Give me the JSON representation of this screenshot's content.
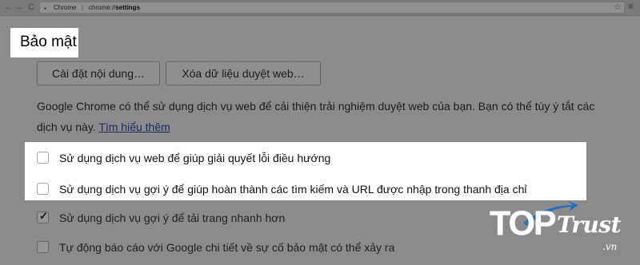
{
  "browser": {
    "nav": {
      "back": "←",
      "forward": "→",
      "reload": "C"
    },
    "tab_label": "Chrome",
    "url_separator": "|",
    "url_scheme": "chrome://",
    "url_path": "settings",
    "star": "☆",
    "menu": "≡"
  },
  "section": {
    "title": "Bảo mật"
  },
  "buttons": {
    "content_settings": "Cài đặt nội dung…",
    "clear_browsing_data": "Xóa dữ liệu duyệt web…"
  },
  "description": {
    "text": "Google Chrome có thể sử dụng dịch vụ web để cải thiện trải nghiệm duyệt web của bạn. Bạn có thể tùy ý tắt các dịch vụ này.",
    "link": "Tìm hiểu thêm"
  },
  "options": [
    {
      "label": "Sử dụng dịch vụ web để giúp giải quyết lỗi điều hướng",
      "checked": false
    },
    {
      "label": "Sử dụng dịch vụ gợi ý để giúp hoàn thành các tìm kiếm và URL được nhập trong thanh địa chỉ",
      "checked": false
    },
    {
      "label": "Sử dụng dịch vụ gợi ý để tải trang nhanh hơn",
      "checked": true
    },
    {
      "label": "Tự động báo cáo với Google chi tiết về sự cố bảo mật có thể xảy ra",
      "checked": false
    }
  ],
  "checkmark": "✓",
  "watermark": {
    "top": "TOP",
    "trust": "Trust",
    "domain": ".vn"
  },
  "colors": {
    "dim_overlay": "#8b8b8b",
    "highlight": "#ffffff",
    "link": "#1c2f68"
  }
}
